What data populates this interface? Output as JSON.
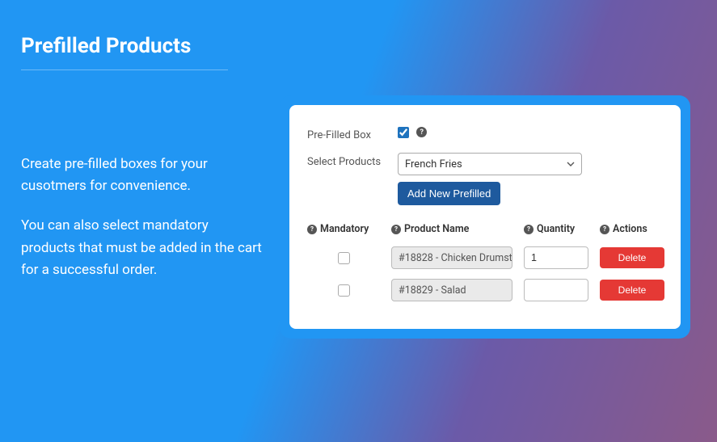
{
  "title": "Prefilled Products",
  "description": {
    "p1": "Create pre-filled boxes for your cusotmers for convenience.",
    "p2": "You can also select mandatory products that must be added in the cart for a successful order."
  },
  "form": {
    "prefilled_label": "Pre-Filled Box",
    "prefilled_checked": true,
    "select_label": "Select Products",
    "select_value": "French Fries",
    "add_button": "Add New Prefilled"
  },
  "table": {
    "headers": {
      "mandatory": "Mandatory",
      "product": "Product Name",
      "quantity": "Quantity",
      "actions": "Actions"
    },
    "rows": [
      {
        "mandatory": false,
        "product": "#18828 - Chicken Drumst",
        "quantity": "1",
        "action": "Delete"
      },
      {
        "mandatory": false,
        "product": "#18829 - Salad",
        "quantity": "",
        "action": "Delete"
      }
    ]
  }
}
